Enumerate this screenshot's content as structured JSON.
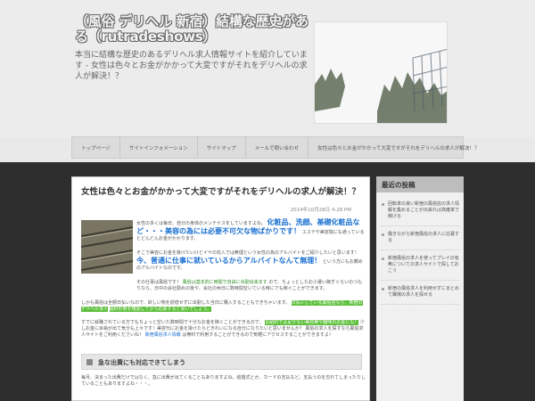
{
  "header": {
    "title": "（風俗 デリヘル 新宿）結構な歴史がある（rutradeshows）",
    "description": "本当に結構な歴史のあるデリヘル求人情報サイトを紹介しています - 女性は色々とお金がかかって大変ですがそれをデリヘルの求人が解決！？"
  },
  "nav": {
    "items": [
      {
        "label": "トップページ"
      },
      {
        "label": "サイトインフォメーション"
      },
      {
        "label": "サイトマップ"
      },
      {
        "label": "メールで問い合わせ"
      },
      {
        "label": "女性は色々とお金がかかって大変ですがそれをデリヘルの求人が解決！？"
      }
    ]
  },
  "post": {
    "title": "女性は色々とお金がかかって大変ですがそれをデリヘルの求人が解決！？",
    "date": "2014年10月28日 4:28 PM",
    "p1": "女性の多くは毎日、自分の身体のメンテナスをしていますよね。",
    "emph1": "化粧品、洗顔、基礎化粧品など・・・美容の為には必要不可欠な物ばかりです！",
    "p1b": "エステや美容院にも通っているとどんどんお金がかかります。",
    "p2": "そこで美容にお金を掛けたいけどイヤの収入では無理という女性の為のアルバイトをご紹介したいと思います！",
    "emph2": "今、普通に仕事に就いているからアルバイトなんて無理！",
    "p2b": "という方にもお薦めのアルバイトなのです。",
    "p3a": "その仕事は風俗です！",
    "p3hl": "風俗は基本的に時間で自由に出勤出来ます",
    "p3b": "ので、ちょっとしたお小遣い稼ぎぐらいのつもりなら、日中の会社勤めの後や、会社の休日に数時間空いている時にでも稼ぐことができます。",
    "p4a": "しかも風俗は全額日払いなので、欲しい物を前借せずに出勤した当日に購入することもできちゃいます。",
    "p4hl": "日払いしている風俗店なら、新宿のデリヘル求人",
    "p4c": "給料形態を確認してから応募すると良いでしょう。",
    "p5a": "すでに就職されている方でもちょっと空いた数時間で十分なお金を稼ぐことができるので、",
    "p5hl": "お給料では足りない美容費や趣味のお金にも！",
    "p5b": "少しお金に余裕が出て気分も上々です！美容代にお金を掛けたらどきれいになる自分になりたいと思いませんか？",
    "p5c": "風俗の求人を探すなら風俗求人サイトをご利用くださいね！",
    "p5link": "新宿風俗求人情報",
    "p5d": "は無料で利用することができるので気軽にアクセスすることができますよ！",
    "subhead": "急な出費にも対応できてしまう",
    "p6": "毎月、決まった出費だけではなく、急に出費が出てくることもありますよね。結婚式とか、カードの支払など。支払うのを忘れてしまったりしていることもありますよね・・・。"
  },
  "sidebar": {
    "heading": "最近の投稿",
    "items": [
      {
        "label": "回転率の良い新宿の風俗店の求人情報を集めることが出来れば高確率で稼げる"
      },
      {
        "label": "働きながら新宿風俗の求人に応募する"
      },
      {
        "label": "新宿風俗の求人を使ってプレイの有無についての求人サイトで探しておこう"
      },
      {
        "label": "新宿の風俗求人を利用せずにまとめて職場の求人を探せる"
      }
    ]
  },
  "colors": {
    "title_fill": "#f4f4f4",
    "dark_background": "#2e2e2e",
    "accent_blue": "#1a6fd0",
    "highlight_green": "#5cbf3a"
  }
}
